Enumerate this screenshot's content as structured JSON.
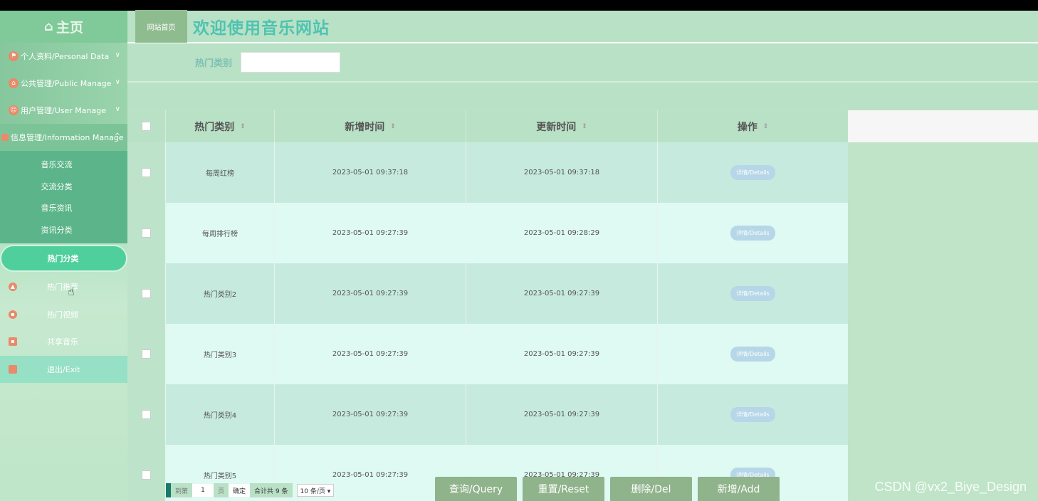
{
  "sidebar": {
    "home_label": "主页",
    "groups": [
      {
        "label": "个人资料/Personal Data"
      },
      {
        "label": "公共管理/Public Manage"
      },
      {
        "label": "用户管理/User Manage"
      },
      {
        "label": "信息管理/Information Manage"
      }
    ],
    "sub_items": [
      "音乐交流",
      "交流分类",
      "音乐资讯",
      "资讯分类"
    ],
    "active_item": "热门分类",
    "items": [
      "热门推荐",
      "热门视频",
      "共享音乐"
    ],
    "exit_label": "退出/Exit"
  },
  "header": {
    "breadcrumb": "网站首页",
    "title": "欢迎使用音乐网站"
  },
  "search": {
    "label": "热门类别",
    "value": ""
  },
  "table": {
    "columns": [
      "热门类别",
      "新增时间",
      "更新时间",
      "操作"
    ],
    "rows": [
      {
        "category": "每周红榜",
        "created": "2023-05-01 09:37:18",
        "updated": "2023-05-01 09:37:18",
        "action": "详情/Details"
      },
      {
        "category": "每周排行榜",
        "created": "2023-05-01 09:27:39",
        "updated": "2023-05-01 09:28:29",
        "action": "详情/Details"
      },
      {
        "category": "热门类别2",
        "created": "2023-05-01 09:27:39",
        "updated": "2023-05-01 09:27:39",
        "action": "详情/Details"
      },
      {
        "category": "热门类别3",
        "created": "2023-05-01 09:27:39",
        "updated": "2023-05-01 09:27:39",
        "action": "详情/Details"
      },
      {
        "category": "热门类别4",
        "created": "2023-05-01 09:27:39",
        "updated": "2023-05-01 09:27:39",
        "action": "详情/Details"
      },
      {
        "category": "热门类别5",
        "created": "2023-05-01 09:27:39",
        "updated": "2023-05-01 09:27:39",
        "action": "详情/Details"
      }
    ]
  },
  "pager": {
    "goto_label": "到第",
    "page_value": "1",
    "page_unit": "页",
    "confirm": "确定",
    "total": "合计共 9 条",
    "page_size": "10 条/页 ▾"
  },
  "actions": {
    "query": "查询/Query",
    "reset": "重置/Reset",
    "delete": "删除/Del",
    "add": "新增/Add"
  },
  "watermark": "CSDN @vx2_Biye_Design",
  "colors": {
    "sidebar": "#8fd0a6",
    "active_pill": "#4ecf9c",
    "title": "#4fc3b0",
    "action_button": "#8fb38a",
    "detail_button": "#b6d7e8"
  }
}
